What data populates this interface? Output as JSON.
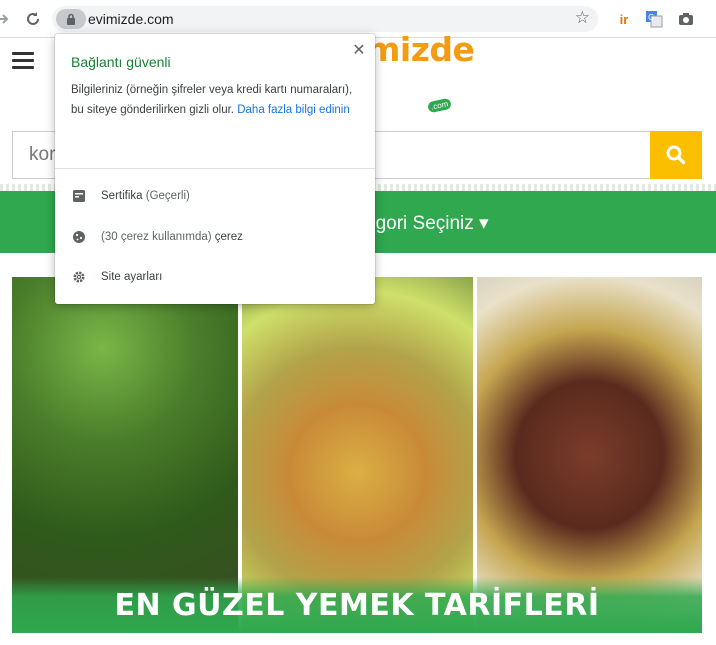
{
  "browser": {
    "url": "evimizde.com"
  },
  "site": {
    "logo_text": "mizde",
    "logo_badge": ".com",
    "search_placeholder": "kor",
    "category_label": "egori Seçiniz ▾",
    "banner_title": "EN GÜZEL YEMEK TARİFLERİ"
  },
  "popup": {
    "title": "Bağlantı güvenli",
    "description": "Bilgileriniz (örneğin şifreler veya kredi kartı numaraları), bu siteye gönderilirken gizli olur.",
    "link": "Daha fazla bilgi edinin",
    "rows": [
      {
        "label": "Sertifika",
        "detail": "(Geçerli)",
        "icon": "certificate-icon"
      },
      {
        "label": "(30 çerez kullanımda)",
        "detail": "çerez",
        "icon": "cookie-icon"
      },
      {
        "label": "Site ayarları",
        "detail": "",
        "icon": "gear-icon"
      }
    ]
  },
  "colors": {
    "accent_green": "#2fa84f",
    "search_yellow": "#fbbf00",
    "logo_orange": "#f39c12",
    "secure_green": "#188038",
    "link_blue": "#1a73e8"
  }
}
